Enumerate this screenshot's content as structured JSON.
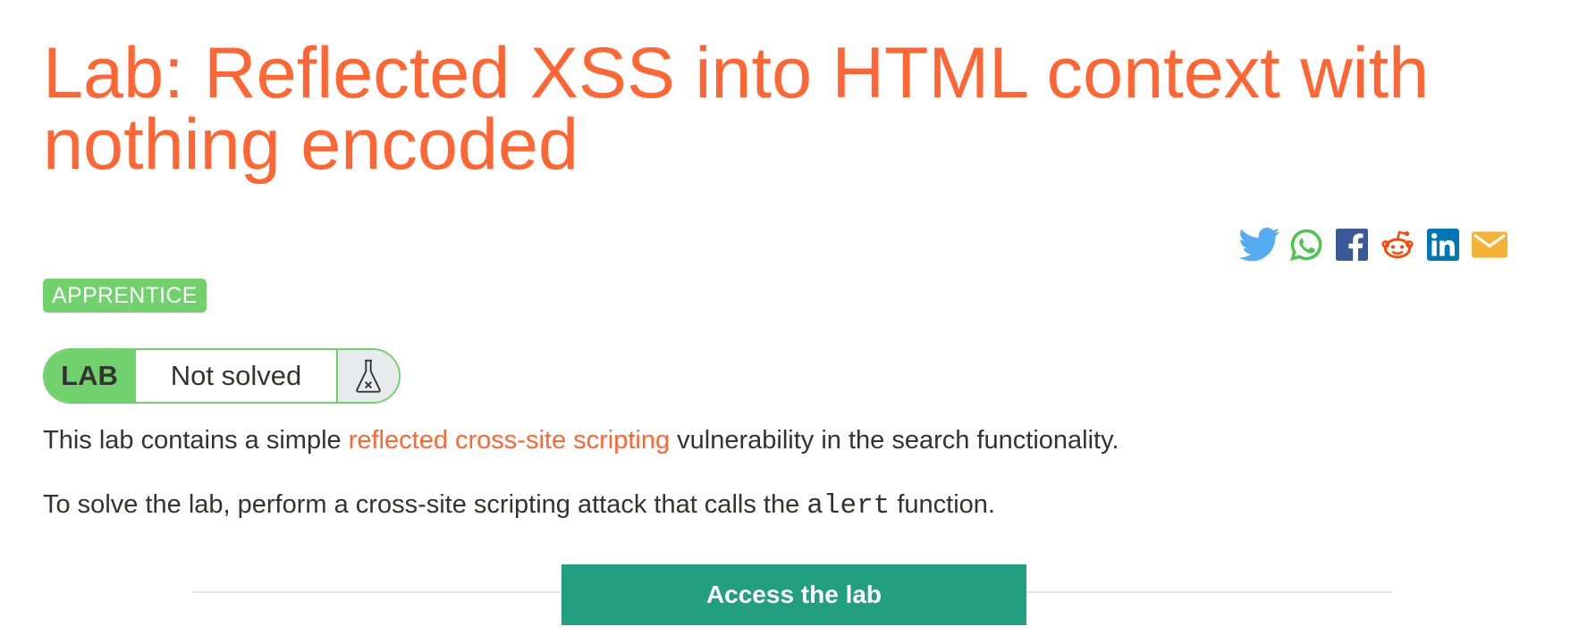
{
  "page_title": "Lab: Reflected XSS into HTML context with nothing encoded",
  "share": {
    "icons": [
      "twitter-icon",
      "whatsapp-icon",
      "facebook-icon",
      "reddit-icon",
      "linkedin-icon",
      "email-icon"
    ],
    "colors": {
      "twitter": "#55acee",
      "whatsapp": "#4fc34f",
      "facebook": "#3b5998",
      "reddit": "#ff4500",
      "linkedin": "#0077b5",
      "email": "#f5b335"
    }
  },
  "level": "APPRENTICE",
  "status": {
    "lab_label": "LAB",
    "state": "Not solved",
    "icon": "flask-icon"
  },
  "description": {
    "p1_before": "This lab contains a simple ",
    "p1_link": "reflected cross-site scripting",
    "p1_after": " vulnerability in the search functionality.",
    "p2_before": "To solve the lab, perform a cross-site scripting attack that calls the ",
    "p2_code": "alert",
    "p2_after": " function."
  },
  "access_button_label": "Access the lab",
  "colors": {
    "accent": "#ff6633",
    "level_green": "#70d16d",
    "button_teal": "#229f81",
    "text": "#333332"
  }
}
